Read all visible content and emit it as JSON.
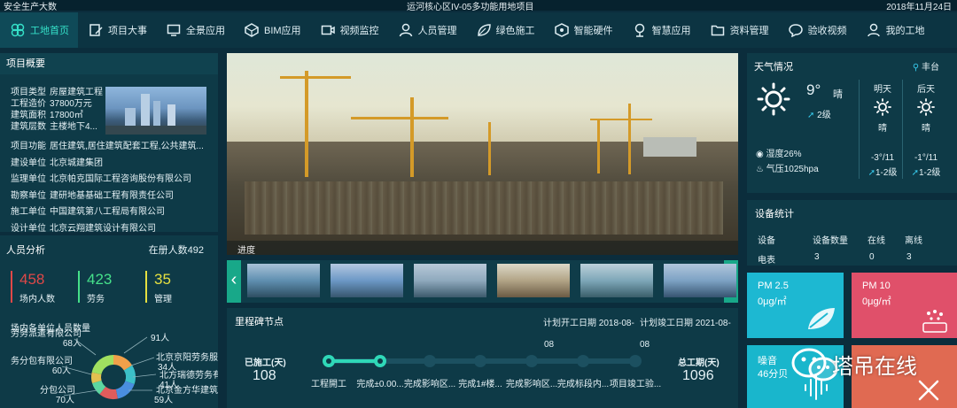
{
  "topbar": {
    "left": "安全生产大数",
    "center": "运河核心区IV-05多功能用地项目",
    "date": "2018年11月24日"
  },
  "nav": [
    {
      "label": "工地首页",
      "icon": "clover-icon",
      "active": true
    },
    {
      "label": "项目大事",
      "icon": "edit-icon"
    },
    {
      "label": "全景应用",
      "icon": "monitor-icon"
    },
    {
      "label": "BIM应用",
      "icon": "cube-icon"
    },
    {
      "label": "视频监控",
      "icon": "video-icon"
    },
    {
      "label": "人员管理",
      "icon": "person-icon"
    },
    {
      "label": "绿色施工",
      "icon": "leaf-icon"
    },
    {
      "label": "智能硬件",
      "icon": "box-icon"
    },
    {
      "label": "智慧应用",
      "icon": "tree-icon"
    },
    {
      "label": "资料管理",
      "icon": "folder-icon"
    },
    {
      "label": "验收视频",
      "icon": "chat-icon"
    },
    {
      "label": "我的工地",
      "icon": "user-icon"
    }
  ],
  "overview": {
    "title": "项目概要",
    "facts": [
      {
        "k": "项目类型",
        "v": "房屋建筑工程"
      },
      {
        "k": "工程造价",
        "v": "37800万元"
      },
      {
        "k": "建筑面积",
        "v": "17800㎡"
      },
      {
        "k": "建筑层数",
        "v": "主楼地下4..."
      }
    ],
    "rows": [
      {
        "k": "项目功能",
        "v": "居住建筑,居住建筑配套工程,公共建筑..."
      },
      {
        "k": "建设单位",
        "v": "北京城建集团"
      },
      {
        "k": "监理单位",
        "v": "北京帕克国际工程咨询股份有限公司"
      },
      {
        "k": "勘察单位",
        "v": "建研地基基础工程有限责任公司"
      },
      {
        "k": "施工单位",
        "v": "中国建筑第八工程局有限公司"
      },
      {
        "k": "设计单位",
        "v": "北京云翔建筑设计有限公司"
      }
    ]
  },
  "staff": {
    "title": "人员分析",
    "registered": "在册人数492",
    "stats": [
      {
        "value": "458",
        "label": "场内人数",
        "color": "#e04848"
      },
      {
        "value": "423",
        "label": "劳务",
        "color": "#45e08a"
      },
      {
        "value": "35",
        "label": "管理",
        "color": "#e6e040"
      }
    ],
    "units_title": "场内各单位人员数量"
  },
  "chart_data": {
    "type": "pie",
    "labels": [
      "劳务派遣有限公司",
      "务分包有限公司",
      "分包公司",
      "北京金方华建筑",
      "北方瑞德劳务有",
      "北京京阳劳务服",
      "(unlabeled)"
    ],
    "values": [
      68,
      60,
      70,
      59,
      41,
      34,
      91
    ],
    "colors": [
      "#f0a04a",
      "#3cc0c8",
      "#4a8ee0",
      "#e05c5c",
      "#5cd6a0",
      "#e4c050",
      "#a0e060"
    ],
    "value_labels": [
      "68人",
      "60人",
      "70人",
      "59人",
      "41人",
      "34人",
      "91人"
    ]
  },
  "video": {
    "caption": "进度",
    "left_arrow": "‹",
    "right_arrow": "›"
  },
  "milestones": {
    "title": "里程碑节点",
    "plan_start": "计划开工日期 2018-08-",
    "plan_end": "计划竣工日期 2021-08-",
    "top_dates": [
      "08",
      "08"
    ],
    "done_label": "已施工(天)",
    "done_value": "108",
    "total_label": "总工期(天)",
    "total_value": "1096",
    "steps": [
      "工程開工",
      "完成±0.00...",
      "完成影响区...",
      "完成1#楼...",
      "完成影响区...",
      "完成标段内...",
      "项目竣工验..."
    ],
    "progress": 0.17
  },
  "weather": {
    "title": "天气情况",
    "location": "丰台",
    "temp": "9°",
    "cond": "晴",
    "wind": "2级",
    "humidity": "湿度26%",
    "pressure": "气压1025hpa",
    "days": [
      {
        "name": "明天",
        "cond": "晴",
        "range": "-3°/11",
        "wind": "1-2级"
      },
      {
        "name": "后天",
        "cond": "晴",
        "range": "-1°/11",
        "wind": "1-2级"
      }
    ]
  },
  "devices": {
    "title": "设备统计",
    "headers": [
      "设备",
      "设备数量",
      "在线",
      "离线"
    ],
    "rows": [
      [
        "电表",
        "3",
        "0",
        "3"
      ]
    ]
  },
  "env": [
    {
      "title": "PM 2.5",
      "value": "0μg/㎡",
      "color": "#1db8d2"
    },
    {
      "title": "PM 10",
      "value": "0μg/㎡",
      "color": "#e0506a"
    },
    {
      "title": "噪音",
      "value": "46分贝",
      "color": "#19b6cc"
    },
    {
      "title": "",
      "value": "",
      "color": "#e06a52"
    }
  ],
  "watermark": "塔吊在线"
}
